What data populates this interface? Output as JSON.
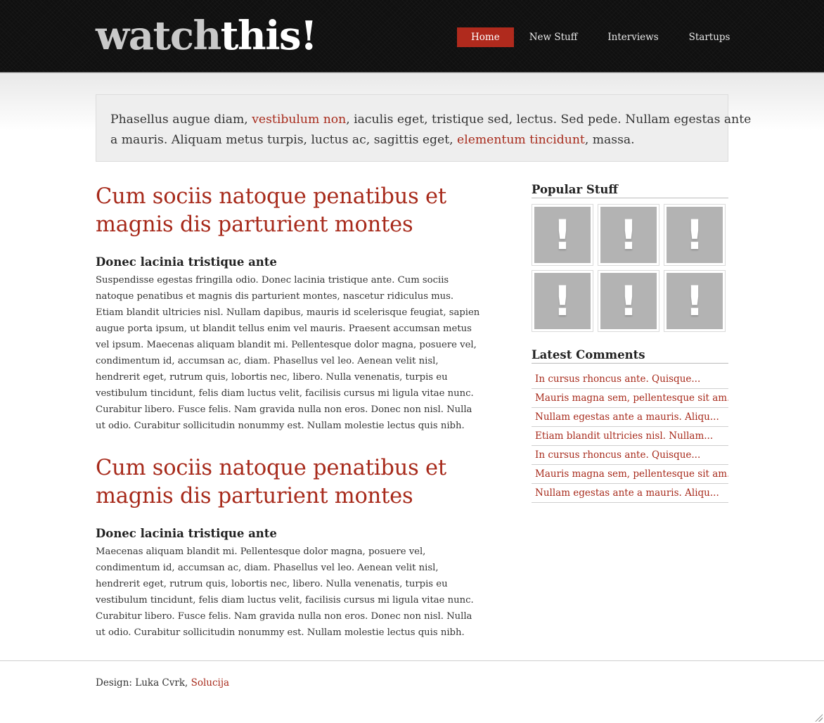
{
  "header": {
    "logo_part1": "watch",
    "logo_part2": "this!",
    "nav": [
      {
        "label": "Home",
        "active": true
      },
      {
        "label": "New Stuff",
        "active": false
      },
      {
        "label": "Interviews",
        "active": false
      },
      {
        "label": "Startups",
        "active": false
      }
    ]
  },
  "intro": {
    "t1": "Phasellus augue diam, ",
    "link1": "vestibulum non",
    "t2": ", iaculis eget, tristique sed, lectus. Sed pede. Nullam egestas ante",
    "t3": "a mauris. Aliquam metus turpis, luctus ac, sagittis eget, ",
    "link2": "elementum tincidunt",
    "t4": ", massa."
  },
  "articles": [
    {
      "title_line1": "Cum sociis natoque penatibus et",
      "title_line2": "magnis dis parturient montes",
      "subtitle": "Donec lacinia tristique ante",
      "lines": [
        "Suspendisse egestas fringilla odio. Donec lacinia tristique ante. Cum sociis",
        "natoque penatibus et magnis dis parturient montes, nascetur ridiculus mus.",
        "Etiam blandit ultricies nisl. Nullam dapibus, mauris id scelerisque feugiat, sapien",
        "augue porta ipsum, ut blandit tellus enim vel mauris. Praesent accumsan metus",
        "vel ipsum. Maecenas aliquam blandit mi. Pellentesque dolor magna, posuere vel,",
        "condimentum id, accumsan ac, diam. Phasellus vel leo. Aenean velit nisl,",
        "hendrerit eget, rutrum quis, lobortis nec, libero. Nulla venenatis, turpis eu",
        "vestibulum tincidunt, felis diam luctus velit, facilisis cursus mi ligula vitae nunc.",
        "Curabitur libero. Fusce felis. Nam gravida nulla non eros. Donec non nisl. Nulla",
        "ut odio. Curabitur sollicitudin nonummy est. Nullam molestie lectus quis nibh."
      ]
    },
    {
      "title_line1": "Cum sociis natoque penatibus et",
      "title_line2": "magnis dis parturient montes",
      "subtitle": "Donec lacinia tristique ante",
      "lines": [
        "Maecenas aliquam blandit mi. Pellentesque dolor magna, posuere vel,",
        "condimentum id, accumsan ac, diam. Phasellus vel leo. Aenean velit nisl,",
        "hendrerit eget, rutrum quis, lobortis nec, libero. Nulla venenatis, turpis eu",
        "vestibulum tincidunt, felis diam luctus velit, facilisis cursus mi ligula vitae nunc.",
        "Curabitur libero. Fusce felis. Nam gravida nulla non eros. Donec non nisl. Nulla",
        "ut odio. Curabitur sollicitudin nonummy est. Nullam molestie lectus quis nibh."
      ]
    }
  ],
  "sidebar": {
    "popular_title": "Popular Stuff",
    "thumb_glyph": "!",
    "comments_title": "Latest Comments",
    "comments": [
      "In cursus rhoncus ante. Quisque...",
      "Mauris magna sem, pellentesque sit am...",
      "Nullam egestas ante a mauris. Aliqu...",
      "Etiam blandit ultricies nisl. Nullam...",
      "In cursus rhoncus ante. Quisque...",
      "Mauris magna sem, pellentesque sit am...",
      "Nullam egestas ante a mauris. Aliqu..."
    ]
  },
  "footer": {
    "text": "Design: Luka Cvrk, ",
    "link": "Solucija"
  },
  "colors": {
    "accent": "#a72a1b",
    "nav_active": "#b02a1d",
    "header_bg": "#101010"
  }
}
